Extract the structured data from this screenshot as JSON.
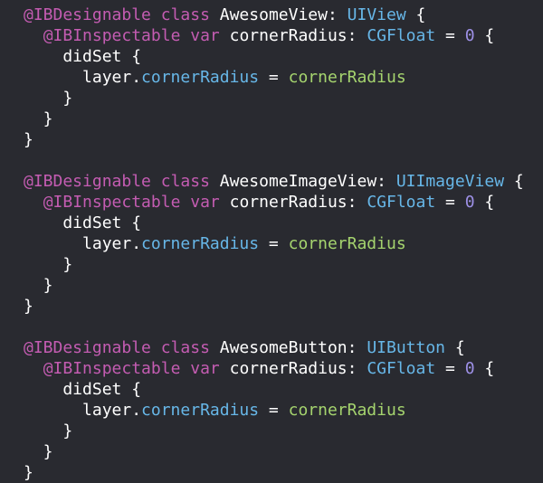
{
  "editor": {
    "colors": {
      "background": "#292a30",
      "attribute": "#c45cb2",
      "keyword": "#c45cb2",
      "plain": "#ffffff",
      "type": "#67b7e8",
      "property": "#67b7e8",
      "number": "#9d90e6",
      "identifier": "#a5d46e"
    },
    "lines": [
      [
        {
          "t": "attribute",
          "v": "@IBDesignable"
        },
        {
          "t": "plain",
          "v": " "
        },
        {
          "t": "keyword",
          "v": "class"
        },
        {
          "t": "plain",
          "v": " AwesomeView: "
        },
        {
          "t": "type",
          "v": "UIView"
        },
        {
          "t": "plain",
          "v": " {"
        }
      ],
      [
        {
          "t": "plain",
          "v": "  "
        },
        {
          "t": "attribute",
          "v": "@IBInspectable"
        },
        {
          "t": "plain",
          "v": " "
        },
        {
          "t": "keyword",
          "v": "var"
        },
        {
          "t": "plain",
          "v": " cornerRadius: "
        },
        {
          "t": "type",
          "v": "CGFloat"
        },
        {
          "t": "plain",
          "v": " = "
        },
        {
          "t": "number",
          "v": "0"
        },
        {
          "t": "plain",
          "v": " {"
        }
      ],
      [
        {
          "t": "plain",
          "v": "    didSet {"
        }
      ],
      [
        {
          "t": "plain",
          "v": "      layer."
        },
        {
          "t": "property",
          "v": "cornerRadius"
        },
        {
          "t": "plain",
          "v": " = "
        },
        {
          "t": "identifier",
          "v": "cornerRadius"
        }
      ],
      [
        {
          "t": "plain",
          "v": "    }"
        }
      ],
      [
        {
          "t": "plain",
          "v": "  }"
        }
      ],
      [
        {
          "t": "plain",
          "v": "}"
        }
      ],
      [
        {
          "t": "plain",
          "v": ""
        }
      ],
      [
        {
          "t": "attribute",
          "v": "@IBDesignable"
        },
        {
          "t": "plain",
          "v": " "
        },
        {
          "t": "keyword",
          "v": "class"
        },
        {
          "t": "plain",
          "v": " AwesomeImageView: "
        },
        {
          "t": "type",
          "v": "UIImageView"
        },
        {
          "t": "plain",
          "v": " {"
        }
      ],
      [
        {
          "t": "plain",
          "v": "  "
        },
        {
          "t": "attribute",
          "v": "@IBInspectable"
        },
        {
          "t": "plain",
          "v": " "
        },
        {
          "t": "keyword",
          "v": "var"
        },
        {
          "t": "plain",
          "v": " cornerRadius: "
        },
        {
          "t": "type",
          "v": "CGFloat"
        },
        {
          "t": "plain",
          "v": " = "
        },
        {
          "t": "number",
          "v": "0"
        },
        {
          "t": "plain",
          "v": " {"
        }
      ],
      [
        {
          "t": "plain",
          "v": "    didSet {"
        }
      ],
      [
        {
          "t": "plain",
          "v": "      layer."
        },
        {
          "t": "property",
          "v": "cornerRadius"
        },
        {
          "t": "plain",
          "v": " = "
        },
        {
          "t": "identifier",
          "v": "cornerRadius"
        }
      ],
      [
        {
          "t": "plain",
          "v": "    }"
        }
      ],
      [
        {
          "t": "plain",
          "v": "  }"
        }
      ],
      [
        {
          "t": "plain",
          "v": "}"
        }
      ],
      [
        {
          "t": "plain",
          "v": ""
        }
      ],
      [
        {
          "t": "attribute",
          "v": "@IBDesignable"
        },
        {
          "t": "plain",
          "v": " "
        },
        {
          "t": "keyword",
          "v": "class"
        },
        {
          "t": "plain",
          "v": " AwesomeButton: "
        },
        {
          "t": "type",
          "v": "UIButton"
        },
        {
          "t": "plain",
          "v": " {"
        }
      ],
      [
        {
          "t": "plain",
          "v": "  "
        },
        {
          "t": "attribute",
          "v": "@IBInspectable"
        },
        {
          "t": "plain",
          "v": " "
        },
        {
          "t": "keyword",
          "v": "var"
        },
        {
          "t": "plain",
          "v": " cornerRadius: "
        },
        {
          "t": "type",
          "v": "CGFloat"
        },
        {
          "t": "plain",
          "v": " = "
        },
        {
          "t": "number",
          "v": "0"
        },
        {
          "t": "plain",
          "v": " {"
        }
      ],
      [
        {
          "t": "plain",
          "v": "    didSet {"
        }
      ],
      [
        {
          "t": "plain",
          "v": "      layer."
        },
        {
          "t": "property",
          "v": "cornerRadius"
        },
        {
          "t": "plain",
          "v": " = "
        },
        {
          "t": "identifier",
          "v": "cornerRadius"
        }
      ],
      [
        {
          "t": "plain",
          "v": "    }"
        }
      ],
      [
        {
          "t": "plain",
          "v": "  }"
        }
      ],
      [
        {
          "t": "plain",
          "v": "}"
        }
      ]
    ]
  }
}
